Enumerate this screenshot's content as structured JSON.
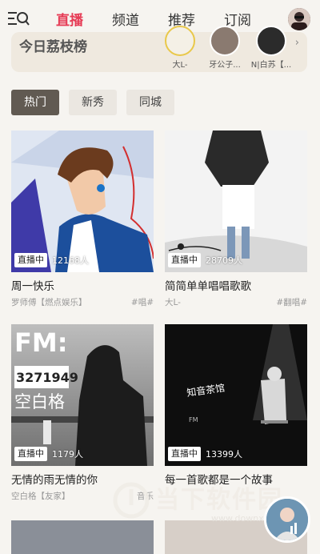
{
  "nav": {
    "tabs": [
      "直播",
      "频道",
      "推荐",
      "订阅"
    ],
    "active_tab": 0
  },
  "ranking": {
    "title": "今日荔枝榜",
    "users": [
      "大L-",
      "牙公子...",
      "N|白苏【..."
    ]
  },
  "filters": {
    "chips": [
      "热门",
      "新秀",
      "同城"
    ],
    "active": 0
  },
  "live_badge": "直播中",
  "cards": [
    {
      "title": "周一快乐",
      "host": "罗师傅【燃点娱乐】",
      "tag": "#唱#",
      "count": "12168人"
    },
    {
      "title": "简简单单唱唱歌歌",
      "host": "大L-",
      "tag": "#翻唱#",
      "count": "28709人"
    },
    {
      "title": "无情的雨无情的你",
      "host": "空白格【友家】",
      "tag": "音乐",
      "count": "1179人"
    },
    {
      "title": "每一首歌都是一个故事",
      "host": "",
      "tag": "",
      "count": "13399人"
    }
  ],
  "poster_text": {
    "fm": "FM:",
    "number": "3271949",
    "name": "空白格",
    "vertical": "知音茶馆"
  },
  "watermark": {
    "text": "当下软件园",
    "url": "www.downxia.com"
  },
  "colors": {
    "accent": "#e63b55",
    "background": "#f6f4f0",
    "chip_active": "#615a52"
  }
}
